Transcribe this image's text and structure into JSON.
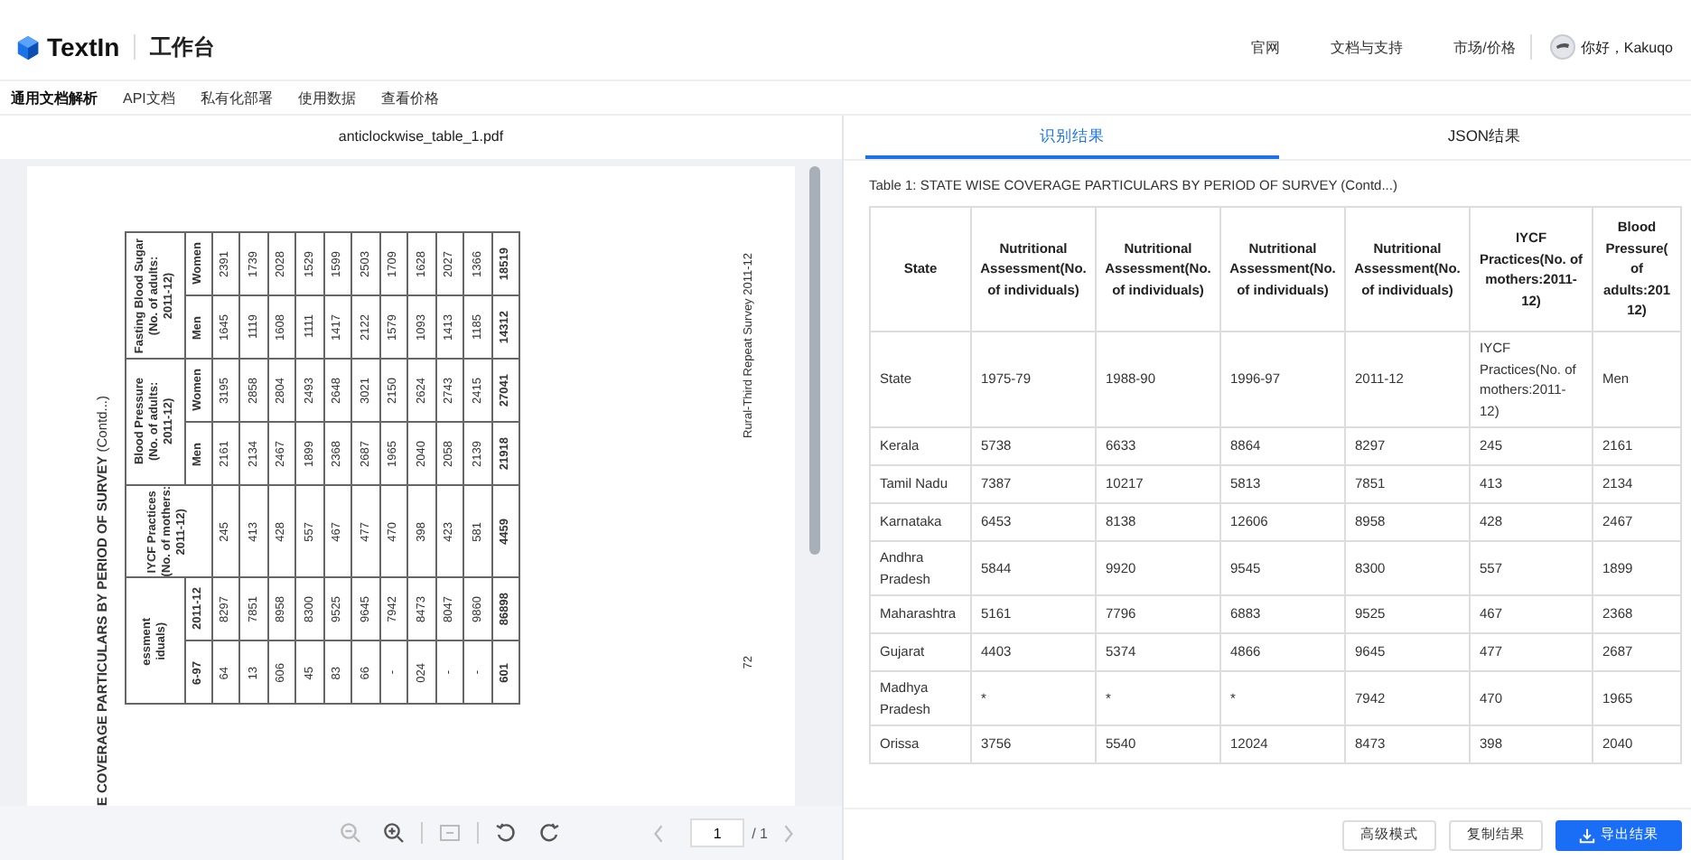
{
  "header": {
    "brand": "TextIn",
    "workspace": "工作台",
    "links": [
      "官网",
      "文档与支持",
      "市场/价格"
    ],
    "greeting": "你好，Kakuqo"
  },
  "nav": [
    {
      "label": "通用文档解析",
      "selected": true
    },
    {
      "label": "API文档",
      "selected": false
    },
    {
      "label": "私有化部署",
      "selected": false
    },
    {
      "label": "使用数据",
      "selected": false
    },
    {
      "label": "查看价格",
      "selected": false
    }
  ],
  "viewer": {
    "file_name": "anticlockwise_table_1.pdf",
    "page": {
      "title": "**E COVERAGE PARTICULARS BY PERIOD OF SURVEY** (Contd...)",
      "side_text": "Rural-Third Repeat Survey 2011-12",
      "page_number": "72",
      "rows": [
        {
          "group": [
            "Fasting Blood Sugar",
            "(No. of adults:",
            "2011-12)"
          ],
          "sub": "Women",
          "cells": [
            "2391",
            "1739",
            "2028",
            "1529",
            "1599",
            "2503",
            "1709",
            "1628",
            "2027",
            "1366"
          ],
          "total": "18519"
        },
        {
          "sub": "Men",
          "cells": [
            "1645",
            "1119",
            "1608",
            "1111",
            "1417",
            "2122",
            "1579",
            "1093",
            "1413",
            "1185"
          ],
          "total": "14312"
        },
        {
          "group": [
            "Blood Pressure",
            "(No. of adults:",
            "2011-12)"
          ],
          "sub": "Women",
          "cells": [
            "3195",
            "2858",
            "2804",
            "2493",
            "2648",
            "3021",
            "2150",
            "2624",
            "2743",
            "2415"
          ],
          "total": "27041"
        },
        {
          "sub": "Men",
          "cells": [
            "2161",
            "2134",
            "2467",
            "1899",
            "2368",
            "2687",
            "1965",
            "2040",
            "2058",
            "2139"
          ],
          "total": "21918"
        },
        {
          "group": [
            "IYCF Practices",
            "(No. of mothers:",
            "2011-12)"
          ],
          "cells": [
            "245",
            "413",
            "428",
            "557",
            "467",
            "477",
            "470",
            "398",
            "423",
            "581"
          ],
          "total": "4459"
        },
        {
          "group": [
            "essment",
            "iduals)"
          ],
          "sub": "2011-12",
          "cells": [
            "8297",
            "7851",
            "8958",
            "8300",
            "9525",
            "9645",
            "7942",
            "8473",
            "8047",
            "9860"
          ],
          "total": "86898"
        },
        {
          "sub": "6-97",
          "cells": [
            "64",
            "13",
            "606",
            "45",
            "83",
            "66",
            "-",
            "024",
            "-",
            "-"
          ],
          "total": "601"
        }
      ]
    },
    "tools": [
      {
        "kind": "zoom-out",
        "disabled": true
      },
      {
        "kind": "zoom-in",
        "disabled": false
      },
      {
        "kind": "fit",
        "disabled": true
      },
      {
        "kind": "rotate-left",
        "disabled": false
      },
      {
        "kind": "rotate-right",
        "disabled": false
      }
    ],
    "pager": {
      "prev_disabled": true,
      "current": "1",
      "total": "/ 1",
      "next_disabled": true
    }
  },
  "result": {
    "tabs": [
      {
        "label": "识别结果",
        "selected": true
      },
      {
        "label": "JSON结果",
        "selected": false
      }
    ],
    "caption": "Table 1: STATE WISE COVERAGE PARTICULARS BY PERIOD OF SURVEY (Contd...)",
    "columns": [
      "State",
      "Nutritional Assessment(No. of individuals)",
      "Nutritional Assessment(No. of individuals)",
      "Nutritional Assessment(No. of individuals)",
      "Nutritional Assessment(No. of individuals)",
      "IYCF Practices(No. of mothers:2011-12)",
      "Blood Pressure( of adults:201 12)"
    ],
    "rows": [
      [
        "State",
        "1975-79",
        "1988-90",
        "1996-97",
        "2011-12",
        "IYCF Practices(No. of mothers:2011-12)",
        "Men"
      ],
      [
        "Kerala",
        "5738",
        "6633",
        "8864",
        "8297",
        "245",
        "2161"
      ],
      [
        "Tamil Nadu",
        "7387",
        "10217",
        "5813",
        "7851",
        "413",
        "2134"
      ],
      [
        "Karnataka",
        "6453",
        "8138",
        "12606",
        "8958",
        "428",
        "2467"
      ],
      [
        "Andhra Pradesh",
        "5844",
        "9920",
        "9545",
        "8300",
        "557",
        "1899"
      ],
      [
        "Maharashtra",
        "5161",
        "7796",
        "6883",
        "9525",
        "467",
        "2368"
      ],
      [
        "Gujarat",
        "4403",
        "5374",
        "4866",
        "9645",
        "477",
        "2687"
      ],
      [
        "Madhya Pradesh",
        "*",
        "*",
        "*",
        "7942",
        "470",
        "1965"
      ],
      [
        "Orissa",
        "3756",
        "5540",
        "12024",
        "8473",
        "398",
        "2040"
      ]
    ],
    "buttons": [
      {
        "label": "高级模式",
        "kind": "default"
      },
      {
        "label": "复制结果",
        "kind": "default"
      },
      {
        "label": "导出结果",
        "kind": "primary"
      }
    ]
  }
}
